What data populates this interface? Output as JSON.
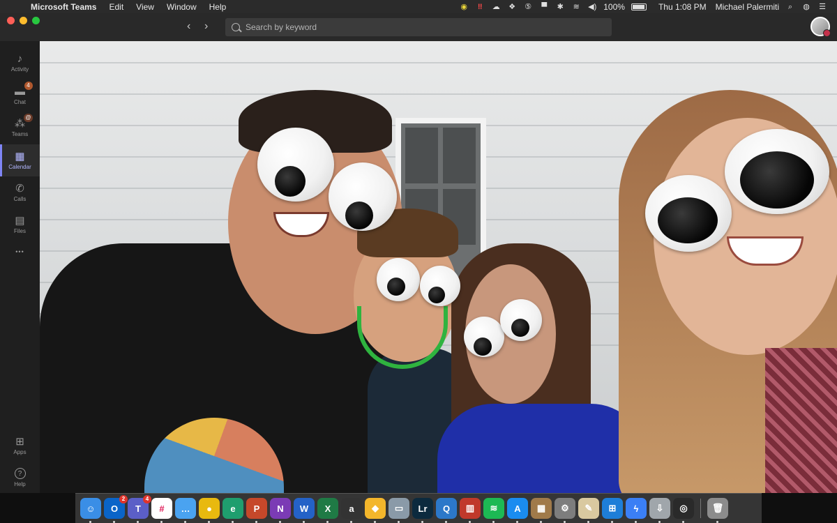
{
  "menubar": {
    "app_name": "Microsoft Teams",
    "menus": [
      "Edit",
      "View",
      "Window",
      "Help"
    ],
    "battery": "100%",
    "clock": "Thu 1:08 PM",
    "user": "Michael Palermiti"
  },
  "toolbar": {
    "search_placeholder": "Search by keyword"
  },
  "rail": {
    "items": [
      {
        "label": "Activity",
        "icon": "bell-icon",
        "glyph": "🔔",
        "badge": ""
      },
      {
        "label": "Chat",
        "icon": "chat-icon",
        "glyph": "💬",
        "badge": "4"
      },
      {
        "label": "Teams",
        "icon": "teams-icon",
        "glyph": "👥",
        "badge": "@"
      },
      {
        "label": "Calendar",
        "icon": "calendar-icon",
        "glyph": "▦",
        "badge": ""
      },
      {
        "label": "Calls",
        "icon": "phone-icon",
        "glyph": "✆",
        "badge": ""
      },
      {
        "label": "Files",
        "icon": "file-icon",
        "glyph": "▤",
        "badge": ""
      }
    ],
    "more": "•••",
    "bottom": [
      {
        "label": "Apps",
        "icon": "apps-icon",
        "glyph": "⊞"
      },
      {
        "label": "Help",
        "icon": "help-icon",
        "glyph": "?"
      }
    ]
  },
  "dock": {
    "apps": [
      {
        "name": "finder",
        "glyph": "☺",
        "color": "#3a8ee6",
        "badge": ""
      },
      {
        "name": "outlook",
        "glyph": "O",
        "color": "#0a64c8",
        "badge": "2"
      },
      {
        "name": "teams",
        "glyph": "T",
        "color": "#5b5fc7",
        "badge": "4"
      },
      {
        "name": "slack",
        "glyph": "#",
        "color": "#ffffff",
        "badge": ""
      },
      {
        "name": "messages",
        "glyph": "…",
        "color": "#4aa3f0",
        "badge": ""
      },
      {
        "name": "chrome",
        "glyph": "●",
        "color": "#e8b90f",
        "badge": ""
      },
      {
        "name": "edge-dev",
        "glyph": "e",
        "color": "#1f9e6e",
        "badge": ""
      },
      {
        "name": "powerpoint",
        "glyph": "P",
        "color": "#c6482a",
        "badge": ""
      },
      {
        "name": "onenote",
        "glyph": "N",
        "color": "#7b3bb5",
        "badge": ""
      },
      {
        "name": "word",
        "glyph": "W",
        "color": "#2462c7",
        "badge": ""
      },
      {
        "name": "excel",
        "glyph": "X",
        "color": "#1f7a45",
        "badge": ""
      },
      {
        "name": "alfred",
        "glyph": "a",
        "color": "#333333",
        "badge": ""
      },
      {
        "name": "sketch",
        "glyph": "◆",
        "color": "#f3b62b",
        "badge": ""
      },
      {
        "name": "preview",
        "glyph": "▭",
        "color": "#8a9aa8",
        "badge": ""
      },
      {
        "name": "lightroom",
        "glyph": "Lr",
        "color": "#0c2a3e",
        "badge": ""
      },
      {
        "name": "quicktime",
        "glyph": "Q",
        "color": "#2c78c9",
        "badge": ""
      },
      {
        "name": "parallels",
        "glyph": "▥",
        "color": "#c0392b",
        "badge": ""
      },
      {
        "name": "spotify",
        "glyph": "≋",
        "color": "#1db954",
        "badge": ""
      },
      {
        "name": "app-store",
        "glyph": "A",
        "color": "#1a8cf0",
        "badge": ""
      },
      {
        "name": "archive-utility",
        "glyph": "▦",
        "color": "#a07a4a",
        "badge": ""
      },
      {
        "name": "system-preferences",
        "glyph": "⚙",
        "color": "#7d7d7d",
        "badge": ""
      },
      {
        "name": "script-editor",
        "glyph": "✎",
        "color": "#d9c9a0",
        "badge": ""
      },
      {
        "name": "windows-vm",
        "glyph": "⊞",
        "color": "#1e7ed8",
        "badge": ""
      },
      {
        "name": "messenger",
        "glyph": "ϟ",
        "color": "#3b7ff5",
        "badge": ""
      },
      {
        "name": "downloads",
        "glyph": "⇩",
        "color": "#a0a6ab",
        "badge": ""
      },
      {
        "name": "app-other",
        "glyph": "◎",
        "color": "#2a2a2a",
        "badge": ""
      },
      {
        "name": "trash",
        "glyph": "🗑",
        "color": "#8c8c8c",
        "badge": ""
      }
    ]
  }
}
